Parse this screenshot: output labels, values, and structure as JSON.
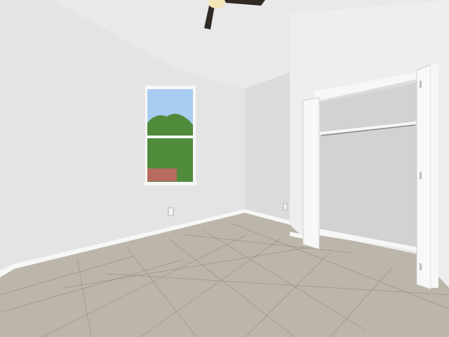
{
  "scene": {
    "kind": "empty-bedroom-interior",
    "palette": {
      "ceiling": "#e9e9e9",
      "left_wall": "#e4e4e4",
      "back_wall": "#dcdcdc",
      "right_wall": "#eeeeee",
      "closet_interior": "#d2d2d2",
      "floor_tile": "#bcb6aa",
      "grout": "#8f897e",
      "baseboard": "#f7f7f7",
      "door_white": "#f8f8f8",
      "sky": "#a9cdf0",
      "foliage": "#4f8b3a",
      "fence": "#b86a60",
      "fan_body": "#2f2a24",
      "fan_light": "#f2e6b8"
    },
    "elements": {
      "ceiling_fan": "ceiling-fan-icon",
      "window": "window-icon",
      "outlet": "outlet-icon",
      "closet": "closet-icon"
    }
  }
}
